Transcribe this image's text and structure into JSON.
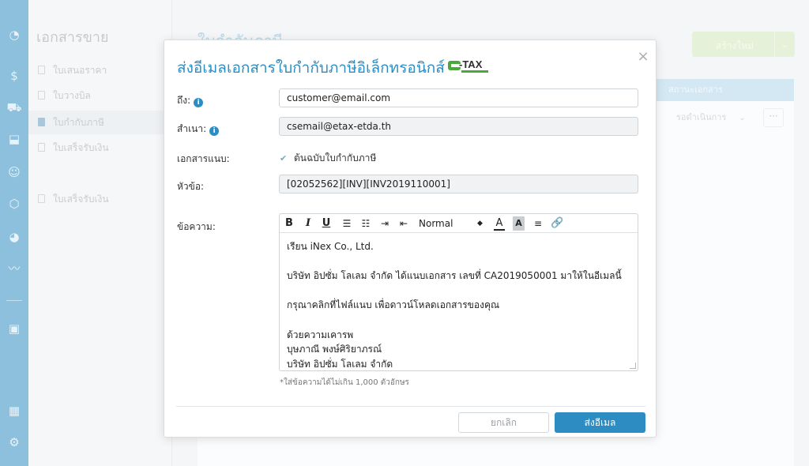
{
  "app": {
    "section_title": "เอกสารขาย",
    "sidebar_items": [
      "ใบเสนอราคา",
      "ใบวางบิล",
      "ใบกำกับภาษี",
      "ใบเสร็จรับเงิน",
      "ใบเสร็จรับเงิน"
    ],
    "page_title": "ใบกำกับภาษี",
    "new_button": "สร้างใหม่",
    "table_header_status": "สถานะเอกสาร",
    "status_value": "รอดำเนินการ"
  },
  "modal": {
    "title": "ส่งอีเมลเอกสารใบกำกับภาษีอิเล็กทรอนิกส์",
    "logo_text": "E-TAX",
    "logo_subtext": "INVOICE & E-RECEIPT",
    "close_symbol": "×",
    "to_label": "ถึง:",
    "to_value": "customer@email.com",
    "cc_label": "สำเนา:",
    "cc_value": "csemail@etax-etda.th",
    "attach_label": "เอกสารแนบ:",
    "attach_option": "ต้นฉบับใบกำกับภาษี",
    "attach_checked": true,
    "subject_label": "หัวข้อ:",
    "subject_value": "[02052562][INV][INV2019110001]",
    "message_label": "ข้อความ:",
    "toolbar": {
      "bold": "B",
      "italic": "I",
      "underline": "U",
      "font_size": "Normal",
      "text_color": "A",
      "bg_color": "A"
    },
    "message_lines": [
      "เรียน iNex Co., Ltd.",
      "",
      "บริษัท อิปซั่ม โลเลม จำกัด ได้แนบเอกสาร เลขที่ CA2019050001 มาให้ในอีเมลนี้",
      "",
      "กรุณาคลิกที่ไฟล์แนบ เพื่อดาวน์โหลดเอกสารของคุณ",
      "",
      "ด้วยความเคารพ",
      "บุษภาณี พงษ์ศิริยาภรณ์",
      "บริษัท อิปซั่ม โลเลม จำกัด"
    ],
    "hint": "*ใส่ข้อความได้ไม่เกิน 1,000 ตัวอักษร",
    "cancel_label": "ยกเลิก",
    "send_label": "ส่งอีเมล"
  },
  "colors": {
    "accent": "#2d8dc2",
    "iconbar": "#8dc0dc",
    "new_button_bg": "#e6f1d9"
  }
}
